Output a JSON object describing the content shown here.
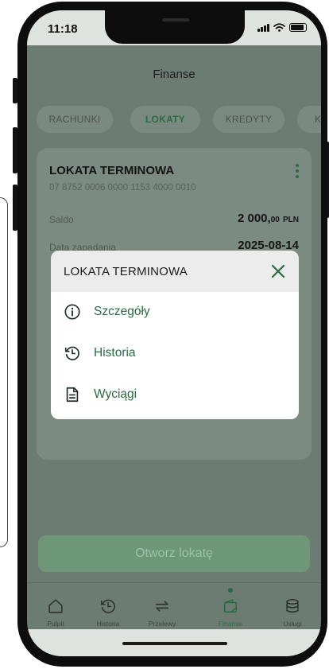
{
  "status_bar": {
    "time": "11:18"
  },
  "header": {
    "title": "Finanse"
  },
  "tabs": [
    {
      "label": "RACHUNKI",
      "active": false
    },
    {
      "label": "LOKATY",
      "active": true
    },
    {
      "label": "KREDYTY",
      "active": false
    },
    {
      "label": "KA",
      "active": false
    }
  ],
  "deposit_card": {
    "title": "LOKATA TERMINOWA",
    "account_number": "07 8752 0006 0000 1153 4000 0010",
    "balance_label": "Saldo",
    "balance_amount": "2 000,",
    "balance_decimals": "00",
    "balance_currency": "PLN",
    "maturity_label": "Data zapadania",
    "maturity_date": "2025-08-14"
  },
  "modal": {
    "title": "LOKATA TERMINOWA",
    "items": [
      {
        "label": "Szczegóły",
        "icon": "info-icon"
      },
      {
        "label": "Historia",
        "icon": "history-icon"
      },
      {
        "label": "Wyciągi",
        "icon": "document-icon"
      }
    ]
  },
  "open_deposit_button": {
    "label": "Otworz lokatę"
  },
  "bottom_nav": [
    {
      "label": "Pulpit",
      "icon": "home-icon",
      "active": false
    },
    {
      "label": "Historia",
      "icon": "history-icon",
      "active": false
    },
    {
      "label": "Przelewy",
      "icon": "transfer-icon",
      "active": false
    },
    {
      "label": "Finanse",
      "icon": "wallet-icon",
      "active": true
    },
    {
      "label": "Usługi",
      "icon": "database-icon",
      "active": false
    }
  ],
  "colors": {
    "brand_green": "#2a6b45",
    "overlay": "#6d7c72",
    "modal_header": "#ececec"
  }
}
